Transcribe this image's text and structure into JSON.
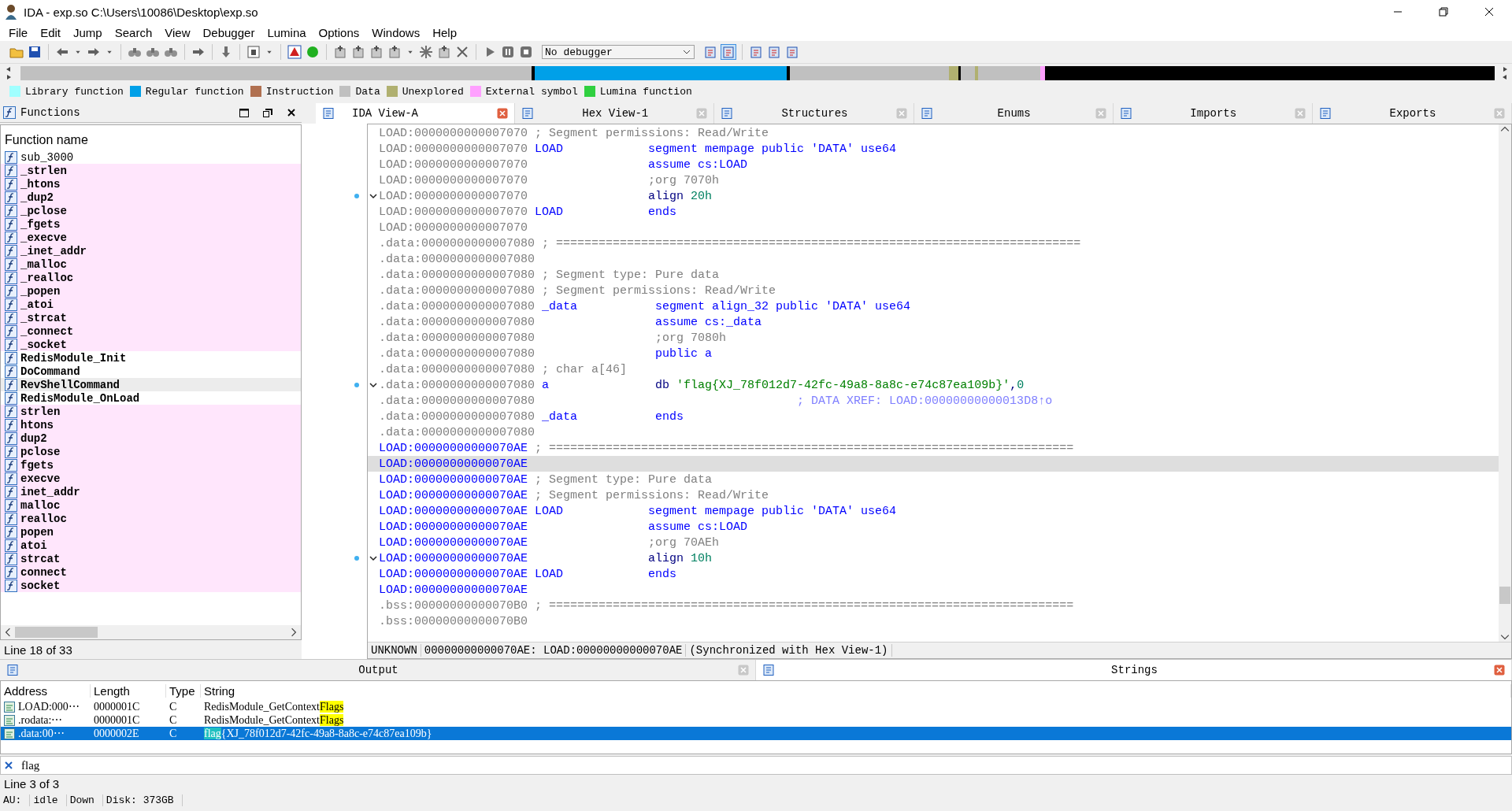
{
  "window": {
    "title": "IDA - exp.so C:\\Users\\10086\\Desktop\\exp.so"
  },
  "menu": [
    "File",
    "Edit",
    "Jump",
    "Search",
    "View",
    "Debugger",
    "Lumina",
    "Options",
    "Windows",
    "Help"
  ],
  "toolbar": {
    "debugger_select": "No debugger"
  },
  "legend": [
    {
      "label": "Library function",
      "color": "#a0ffff"
    },
    {
      "label": "Regular function",
      "color": "#00a0e8"
    },
    {
      "label": "Instruction",
      "color": "#b07050"
    },
    {
      "label": "Data",
      "color": "#c0c0c0"
    },
    {
      "label": "Unexplored",
      "color": "#b0b070"
    },
    {
      "label": "External symbol",
      "color": "#ffa0ff"
    },
    {
      "label": "Lumina function",
      "color": "#30d040"
    }
  ],
  "functions": {
    "title": "Functions",
    "column": "Function name",
    "status": "Line 18 of 33",
    "items": [
      {
        "name": "sub_3000",
        "kind": "regular",
        "selected": false
      },
      {
        "name": "_strlen",
        "kind": "external",
        "selected": false
      },
      {
        "name": "_htons",
        "kind": "external",
        "selected": false
      },
      {
        "name": "_dup2",
        "kind": "external",
        "selected": false
      },
      {
        "name": "_pclose",
        "kind": "external",
        "selected": false
      },
      {
        "name": "_fgets",
        "kind": "external",
        "selected": false
      },
      {
        "name": "_execve",
        "kind": "external",
        "selected": false
      },
      {
        "name": "_inet_addr",
        "kind": "external",
        "selected": false
      },
      {
        "name": "_malloc",
        "kind": "external",
        "selected": false
      },
      {
        "name": "_realloc",
        "kind": "external",
        "selected": false
      },
      {
        "name": "_popen",
        "kind": "external",
        "selected": false
      },
      {
        "name": "_atoi",
        "kind": "external",
        "selected": false
      },
      {
        "name": "_strcat",
        "kind": "external",
        "selected": false
      },
      {
        "name": "_connect",
        "kind": "external",
        "selected": false
      },
      {
        "name": "_socket",
        "kind": "external",
        "selected": false
      },
      {
        "name": "RedisModule_Init",
        "kind": "named",
        "selected": false
      },
      {
        "name": "DoCommand",
        "kind": "named",
        "selected": false
      },
      {
        "name": "RevShellCommand",
        "kind": "named",
        "selected": true
      },
      {
        "name": "RedisModule_OnLoad",
        "kind": "named",
        "selected": false
      },
      {
        "name": "strlen",
        "kind": "external",
        "selected": false
      },
      {
        "name": "htons",
        "kind": "external",
        "selected": false
      },
      {
        "name": "dup2",
        "kind": "external",
        "selected": false
      },
      {
        "name": "pclose",
        "kind": "external",
        "selected": false
      },
      {
        "name": "fgets",
        "kind": "external",
        "selected": false
      },
      {
        "name": "execve",
        "kind": "external",
        "selected": false
      },
      {
        "name": "inet_addr",
        "kind": "external",
        "selected": false
      },
      {
        "name": "malloc",
        "kind": "external",
        "selected": false
      },
      {
        "name": "realloc",
        "kind": "external",
        "selected": false
      },
      {
        "name": "popen",
        "kind": "external",
        "selected": false
      },
      {
        "name": "atoi",
        "kind": "external",
        "selected": false
      },
      {
        "name": "strcat",
        "kind": "external",
        "selected": false
      },
      {
        "name": "connect",
        "kind": "external",
        "selected": false
      },
      {
        "name": "socket",
        "kind": "external",
        "selected": false
      }
    ]
  },
  "tabs": [
    {
      "label": "IDA View-A",
      "selected": true
    },
    {
      "label": "Hex View-1",
      "selected": false
    },
    {
      "label": "Structures",
      "selected": false
    },
    {
      "label": "Enums",
      "selected": false
    },
    {
      "label": "Imports",
      "selected": false
    },
    {
      "label": "Exports",
      "selected": false
    }
  ],
  "listing": {
    "lines": [
      {
        "address": "LOAD:0000000000007070",
        "current_segment": false,
        "selected": false,
        "fold": false,
        "kind": "comment",
        "parts": [
          {
            "text": "; Segment permissions: Read/Write",
            "kind": "comment"
          }
        ]
      },
      {
        "address": "LOAD:0000000000007070",
        "current_segment": false,
        "selected": false,
        "fold": false,
        "kind": "instruction",
        "label": "LOAD",
        "parts": [
          {
            "text": "segment mempage public 'DATA' use64",
            "kind": "directive"
          }
        ]
      },
      {
        "address": "LOAD:0000000000007070",
        "current_segment": false,
        "selected": false,
        "fold": false,
        "kind": "instruction",
        "parts": [
          {
            "text": "assume cs:LOAD",
            "kind": "directive"
          }
        ]
      },
      {
        "address": "LOAD:0000000000007070",
        "current_segment": false,
        "selected": false,
        "fold": false,
        "kind": "instruction",
        "parts": [
          {
            "text": ";org 7070h",
            "kind": "comment"
          }
        ]
      },
      {
        "address": "LOAD:0000000000007070",
        "current_segment": false,
        "selected": false,
        "fold": true,
        "kind": "instruction",
        "parts": [
          {
            "text": "align ",
            "kind": "keyword"
          },
          {
            "text": "20h",
            "kind": "number"
          }
        ]
      },
      {
        "address": "LOAD:0000000000007070",
        "current_segment": false,
        "selected": false,
        "fold": false,
        "kind": "instruction",
        "label": "LOAD",
        "parts": [
          {
            "text": "ends",
            "kind": "directive"
          }
        ]
      },
      {
        "address": "LOAD:0000000000007070",
        "current_segment": false,
        "selected": false,
        "fold": false,
        "kind": "comment"
      },
      {
        "address": ".data:0000000000007080",
        "current_segment": false,
        "selected": false,
        "fold": false,
        "kind": "comment",
        "parts": [
          {
            "text": "; ==========================================================================",
            "kind": "comment"
          }
        ]
      },
      {
        "address": ".data:0000000000007080",
        "current_segment": false,
        "selected": false,
        "fold": false,
        "kind": "comment"
      },
      {
        "address": ".data:0000000000007080",
        "current_segment": false,
        "selected": false,
        "fold": false,
        "kind": "comment",
        "parts": [
          {
            "text": "; Segment type: Pure data",
            "kind": "comment"
          }
        ]
      },
      {
        "address": ".data:0000000000007080",
        "current_segment": false,
        "selected": false,
        "fold": false,
        "kind": "comment",
        "parts": [
          {
            "text": "; Segment permissions: Read/Write",
            "kind": "comment"
          }
        ]
      },
      {
        "address": ".data:0000000000007080",
        "current_segment": false,
        "selected": false,
        "fold": false,
        "kind": "instruction",
        "label": "_data",
        "parts": [
          {
            "text": "segment align_32 public 'DATA' use64",
            "kind": "directive"
          }
        ]
      },
      {
        "address": ".data:0000000000007080",
        "current_segment": false,
        "selected": false,
        "fold": false,
        "kind": "instruction",
        "parts": [
          {
            "text": "assume cs:_data",
            "kind": "directive"
          }
        ]
      },
      {
        "address": ".data:0000000000007080",
        "current_segment": false,
        "selected": false,
        "fold": false,
        "kind": "instruction",
        "parts": [
          {
            "text": ";org 7080h",
            "kind": "comment"
          }
        ]
      },
      {
        "address": ".data:0000000000007080",
        "current_segment": false,
        "selected": false,
        "fold": false,
        "kind": "instruction",
        "parts": [
          {
            "text": "public a",
            "kind": "directive"
          }
        ]
      },
      {
        "address": ".data:0000000000007080",
        "current_segment": false,
        "selected": false,
        "fold": false,
        "kind": "comment",
        "parts": [
          {
            "text": "; char a[46]",
            "kind": "comment"
          }
        ]
      },
      {
        "address": ".data:0000000000007080",
        "current_segment": false,
        "selected": false,
        "fold": true,
        "kind": "instruction",
        "label": "a",
        "parts": [
          {
            "text": "db ",
            "kind": "keyword"
          },
          {
            "text": "'flag{XJ_78f012d7-42fc-49a8-8a8c-e74c87ea109b}'",
            "kind": "string"
          },
          {
            "text": ",",
            "kind": "keyword"
          },
          {
            "text": "0",
            "kind": "number"
          }
        ]
      },
      {
        "address": ".data:0000000000007080",
        "current_segment": false,
        "selected": false,
        "fold": false,
        "kind": "instruction",
        "parts": [
          {
            "text": "; DATA XREF: LOAD:00000000000013D8↑o",
            "kind": "xref"
          }
        ]
      },
      {
        "address": ".data:0000000000007080",
        "current_segment": false,
        "selected": false,
        "fold": false,
        "kind": "instruction",
        "label": "_data",
        "parts": [
          {
            "text": "ends",
            "kind": "directive"
          }
        ]
      },
      {
        "address": ".data:0000000000007080",
        "current_segment": false,
        "selected": false,
        "fold": false,
        "kind": "comment"
      },
      {
        "address": "LOAD:00000000000070AE",
        "current_segment": true,
        "selected": false,
        "fold": false,
        "kind": "comment",
        "parts": [
          {
            "text": "; ==========================================================================",
            "kind": "comment"
          }
        ]
      },
      {
        "address": "LOAD:00000000000070AE",
        "current_segment": true,
        "selected": true,
        "fold": false,
        "kind": "comment"
      },
      {
        "address": "LOAD:00000000000070AE",
        "current_segment": true,
        "selected": false,
        "fold": false,
        "kind": "comment",
        "parts": [
          {
            "text": "; Segment type: Pure data",
            "kind": "comment"
          }
        ]
      },
      {
        "address": "LOAD:00000000000070AE",
        "current_segment": true,
        "selected": false,
        "fold": false,
        "kind": "comment",
        "parts": [
          {
            "text": "; Segment permissions: Read/Write",
            "kind": "comment"
          }
        ]
      },
      {
        "address": "LOAD:00000000000070AE",
        "current_segment": true,
        "selected": false,
        "fold": false,
        "kind": "instruction",
        "label": "LOAD",
        "parts": [
          {
            "text": "segment mempage public 'DATA' use64",
            "kind": "directive"
          }
        ]
      },
      {
        "address": "LOAD:00000000000070AE",
        "current_segment": true,
        "selected": false,
        "fold": false,
        "kind": "instruction",
        "parts": [
          {
            "text": "assume cs:LOAD",
            "kind": "directive"
          }
        ]
      },
      {
        "address": "LOAD:00000000000070AE",
        "current_segment": true,
        "selected": false,
        "fold": false,
        "kind": "instruction",
        "parts": [
          {
            "text": ";org 70AEh",
            "kind": "comment"
          }
        ]
      },
      {
        "address": "LOAD:00000000000070AE",
        "current_segment": true,
        "selected": false,
        "fold": true,
        "kind": "instruction",
        "parts": [
          {
            "text": "align ",
            "kind": "keyword"
          },
          {
            "text": "10h",
            "kind": "number"
          }
        ]
      },
      {
        "address": "LOAD:00000000000070AE",
        "current_segment": true,
        "selected": false,
        "fold": false,
        "kind": "instruction",
        "label": "LOAD",
        "parts": [
          {
            "text": "ends",
            "kind": "directive"
          }
        ]
      },
      {
        "address": "LOAD:00000000000070AE",
        "current_segment": true,
        "selected": false,
        "fold": false,
        "kind": "comment"
      },
      {
        "address": ".bss:00000000000070B0",
        "current_segment": false,
        "selected": false,
        "fold": false,
        "kind": "comment",
        "parts": [
          {
            "text": "; ==========================================================================",
            "kind": "comment"
          }
        ]
      },
      {
        "address": ".bss:00000000000070B0",
        "current_segment": false,
        "selected": false,
        "fold": false,
        "kind": "comment"
      }
    ],
    "status": [
      "UNKNOWN",
      "00000000000070AE: LOAD:00000000000070AE",
      "(Synchronized with Hex View-1)"
    ]
  },
  "bottom_tabs": [
    {
      "label": "Output",
      "selected": false
    },
    {
      "label": "Strings",
      "selected": true
    }
  ],
  "strings": {
    "columns": [
      "Address",
      "Length",
      "Type",
      "String"
    ],
    "rows": [
      {
        "address": "LOAD:000⋯",
        "length": "0000001C",
        "type": "C",
        "selected": false,
        "parts": [
          {
            "text": "RedisModule_GetContext",
            "match": false
          },
          {
            "text": "Flags",
            "match": true
          }
        ]
      },
      {
        "address": ".rodata:⋯",
        "length": "0000001C",
        "type": "C",
        "selected": false,
        "parts": [
          {
            "text": "RedisModule_GetContext",
            "match": false
          },
          {
            "text": "Flags",
            "match": true
          }
        ]
      },
      {
        "address": ".data:00⋯",
        "length": "0000002E",
        "type": "C",
        "selected": true,
        "parts": [
          {
            "text": "flag",
            "match": true
          },
          {
            "text": "{XJ_78f012d7-42fc-49a8-8a8c-e74c87ea109b}",
            "match": false
          }
        ]
      }
    ],
    "filter": "flag",
    "status": "Line 3 of 3"
  },
  "status_bar": [
    "AU:",
    "idle",
    "Down",
    "Disk: 373GB"
  ]
}
